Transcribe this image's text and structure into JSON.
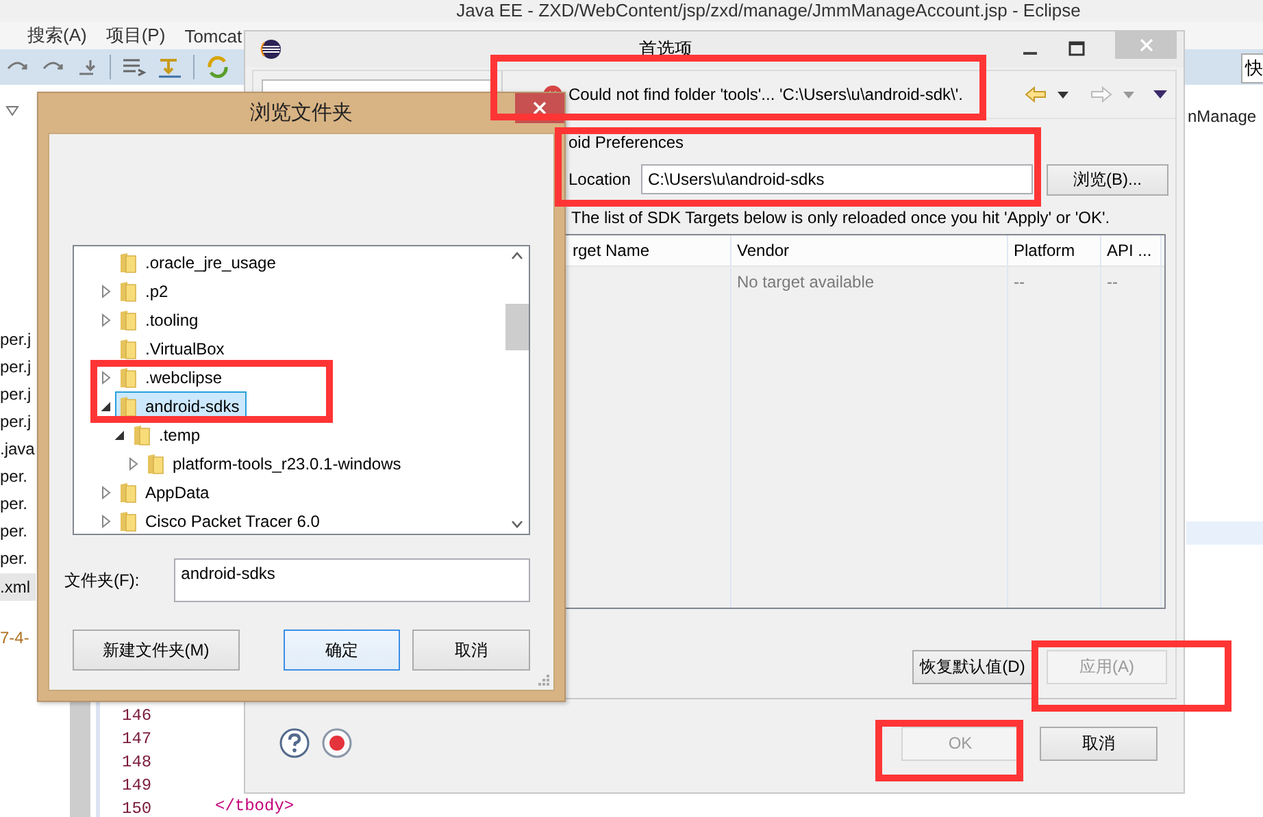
{
  "eclipse": {
    "title": "Java EE  -  ZXD/WebContent/jsp/zxd/manage/JmmManageAccount.jsp  -  Eclipse",
    "menus": [
      "搜索(A)",
      "项目(P)",
      "Tomcat"
    ],
    "quick_access": "快",
    "editor_tab": "nManage",
    "files": [
      "per.j",
      "per.j",
      "per.j",
      "per.j",
      ".java",
      "per.",
      "per.",
      "per.",
      "per.",
      ".xml"
    ],
    "date_fragment": "7-4-",
    "line_numbers": [
      "146",
      "147",
      "148",
      "149",
      "150"
    ],
    "code_line": "</tbody>"
  },
  "preferences": {
    "title": "首选项",
    "message": "Could not find folder 'tools'... 'C:\\Users\\u\\android-sdk\\'.",
    "section": "oid Preferences",
    "location_label": "Location",
    "location": "C:\\Users\\u\\android-sdks",
    "browse": "浏览(B)...",
    "note": "The list of SDK Targets below is only reloaded once you hit 'Apply' or 'OK'.",
    "columns": [
      "rget Name",
      "Vendor",
      "Platform",
      "API ..."
    ],
    "rows": [
      {
        "vendor": "No target available",
        "platform": "--",
        "api": "--"
      }
    ],
    "page_buttons": [
      {
        "label": "恢复默认值(D)",
        "disabled": false
      },
      {
        "label": "应用(A)",
        "disabled": true
      }
    ],
    "dialog_buttons": [
      {
        "label": "OK",
        "disabled": true
      },
      {
        "label": "取消",
        "disabled": false
      }
    ]
  },
  "folder_dialog": {
    "title": "浏览文件夹",
    "tree": [
      {
        "label": ".oracle_jre_usage",
        "expandable": false,
        "selected": false
      },
      {
        "label": ".p2",
        "expandable": true,
        "expanded": false,
        "selected": false
      },
      {
        "label": ".tooling",
        "expandable": true,
        "expanded": false,
        "selected": false
      },
      {
        "label": ".VirtualBox",
        "expandable": false,
        "selected": false
      },
      {
        "label": ".webclipse",
        "expandable": true,
        "expanded": false,
        "selected": false
      },
      {
        "label": "android-sdks",
        "expandable": true,
        "expanded": true,
        "selected": true,
        "children": [
          {
            "label": ".temp",
            "expandable": true,
            "expanded": true,
            "selected": false,
            "children": [
              {
                "label": "platform-tools_r23.0.1-windows",
                "expandable": true,
                "expanded": false,
                "selected": false
              }
            ]
          }
        ]
      },
      {
        "label": "AppData",
        "expandable": true,
        "expanded": false,
        "selected": false
      },
      {
        "label": "Cisco Packet Tracer 6.0",
        "expandable": true,
        "expanded": false,
        "selected": false
      }
    ],
    "folder_label": "文件夹(F):",
    "folder_value": "android-sdks",
    "buttons": [
      {
        "label": "新建文件夹(M)",
        "focused": false
      },
      {
        "label": "确定",
        "focused": true
      },
      {
        "label": "取消",
        "focused": false
      }
    ]
  }
}
